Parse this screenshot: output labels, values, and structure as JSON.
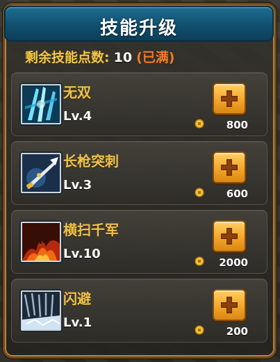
{
  "title": "技能升级",
  "points": {
    "label": "剩余技能点数:",
    "value": "10",
    "status": "(已满)"
  },
  "skills": [
    {
      "name": "无双",
      "level": "Lv.4",
      "cost": "800",
      "icon": "ice-slash-icon"
    },
    {
      "name": "长枪突刺",
      "level": "Lv.3",
      "cost": "600",
      "icon": "spear-thrust-icon"
    },
    {
      "name": "横扫千军",
      "level": "Lv.10",
      "cost": "2000",
      "icon": "fire-sweep-icon"
    },
    {
      "name": "闪避",
      "level": "Lv.1",
      "cost": "200",
      "icon": "dodge-icon"
    }
  ],
  "colors": {
    "title_bar": "#11506f",
    "accent_gold": "#f0c24b",
    "status_orange": "#f07c2b",
    "button": "#f3a629"
  }
}
